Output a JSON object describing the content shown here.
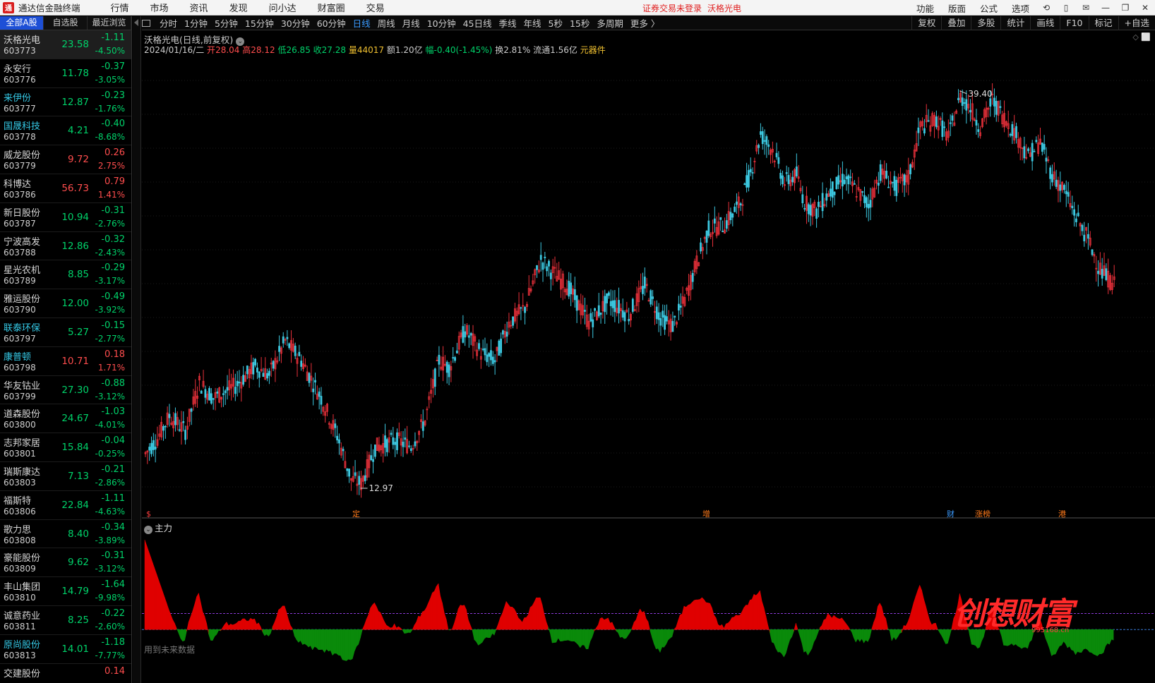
{
  "titlebar": {
    "app_title": "通达信金融终端",
    "logo_glyph": "通",
    "menu": [
      "行情",
      "市场",
      "资讯",
      "发现",
      "问小达",
      "财富圈",
      "交易"
    ],
    "notice": "证券交易未登录",
    "notice_stock": "沃格光电",
    "right_menu": [
      "功能",
      "版面",
      "公式",
      "选项"
    ]
  },
  "list_tabs": [
    "全部A股",
    "自选股",
    "最近浏览"
  ],
  "stocks": [
    {
      "name": "沃格光电",
      "code": "603773",
      "price": "23.58",
      "change": "-1.11",
      "pct": "-4.50%",
      "dir": "dn",
      "cyan": false
    },
    {
      "name": "永安行",
      "code": "603776",
      "price": "11.78",
      "change": "-0.37",
      "pct": "-3.05%",
      "dir": "dn",
      "cyan": false
    },
    {
      "name": "来伊份",
      "code": "603777",
      "price": "12.87",
      "change": "-0.23",
      "pct": "-1.76%",
      "dir": "dn",
      "cyan": true
    },
    {
      "name": "国晟科技",
      "code": "603778",
      "price": "4.21",
      "change": "-0.40",
      "pct": "-8.68%",
      "dir": "dn",
      "cyan": true
    },
    {
      "name": "威龙股份",
      "code": "603779",
      "price": "9.72",
      "change": "0.26",
      "pct": "2.75%",
      "dir": "up",
      "cyan": false
    },
    {
      "name": "科博达",
      "code": "603786",
      "price": "56.73",
      "change": "0.79",
      "pct": "1.41%",
      "dir": "up",
      "cyan": false
    },
    {
      "name": "新日股份",
      "code": "603787",
      "price": "10.94",
      "change": "-0.31",
      "pct": "-2.76%",
      "dir": "dn",
      "cyan": false
    },
    {
      "name": "宁波高发",
      "code": "603788",
      "price": "12.86",
      "change": "-0.32",
      "pct": "-2.43%",
      "dir": "dn",
      "cyan": false
    },
    {
      "name": "星光农机",
      "code": "603789",
      "price": "8.85",
      "change": "-0.29",
      "pct": "-3.17%",
      "dir": "dn",
      "cyan": false
    },
    {
      "name": "雅运股份",
      "code": "603790",
      "price": "12.00",
      "change": "-0.49",
      "pct": "-3.92%",
      "dir": "dn",
      "cyan": false
    },
    {
      "name": "联泰环保",
      "code": "603797",
      "price": "5.27",
      "change": "-0.15",
      "pct": "-2.77%",
      "dir": "dn",
      "cyan": true
    },
    {
      "name": "康普顿",
      "code": "603798",
      "price": "10.71",
      "change": "0.18",
      "pct": "1.71%",
      "dir": "up",
      "cyan": true
    },
    {
      "name": "华友钴业",
      "code": "603799",
      "price": "27.30",
      "change": "-0.88",
      "pct": "-3.12%",
      "dir": "dn",
      "cyan": false
    },
    {
      "name": "道森股份",
      "code": "603800",
      "price": "24.67",
      "change": "-1.03",
      "pct": "-4.01%",
      "dir": "dn",
      "cyan": false
    },
    {
      "name": "志邦家居",
      "code": "603801",
      "price": "15.84",
      "change": "-0.04",
      "pct": "-0.25%",
      "dir": "dn",
      "cyan": false
    },
    {
      "name": "瑞斯康达",
      "code": "603803",
      "price": "7.13",
      "change": "-0.21",
      "pct": "-2.86%",
      "dir": "dn",
      "cyan": false
    },
    {
      "name": "福斯特",
      "code": "603806",
      "price": "22.84",
      "change": "-1.11",
      "pct": "-4.63%",
      "dir": "dn",
      "cyan": false
    },
    {
      "name": "歌力思",
      "code": "603808",
      "price": "8.40",
      "change": "-0.34",
      "pct": "-3.89%",
      "dir": "dn",
      "cyan": false
    },
    {
      "name": "豪能股份",
      "code": "603809",
      "price": "9.62",
      "change": "-0.31",
      "pct": "-3.12%",
      "dir": "dn",
      "cyan": false
    },
    {
      "name": "丰山集团",
      "code": "603810",
      "price": "14.79",
      "change": "-1.64",
      "pct": "-9.98%",
      "dir": "dn",
      "cyan": false
    },
    {
      "name": "诚意药业",
      "code": "603811",
      "price": "8.25",
      "change": "-0.22",
      "pct": "-2.60%",
      "dir": "dn",
      "cyan": false
    },
    {
      "name": "原尚股份",
      "code": "603813",
      "price": "14.01",
      "change": "-1.18",
      "pct": "-7.77%",
      "dir": "dn",
      "cyan": true
    },
    {
      "name": "交建股份",
      "code": "",
      "price": "",
      "change": "0.14",
      "pct": "",
      "dir": "up",
      "cyan": false
    }
  ],
  "periods": [
    "分时",
    "1分钟",
    "5分钟",
    "15分钟",
    "30分钟",
    "60分钟",
    "日线",
    "周线",
    "月线",
    "10分钟",
    "45日线",
    "季线",
    "年线",
    "5秒",
    "15秒",
    "多周期",
    "更多 〉"
  ],
  "active_period": "日线",
  "tools": [
    "复权",
    "叠加",
    "多股",
    "统计",
    "画线",
    "F10",
    "标记",
    "+自选"
  ],
  "chart": {
    "stock_title": "沃格光电(日线,前复权)",
    "date": "2024/01/16/二",
    "open_label": "开",
    "open": "28.04",
    "high_label": "高",
    "high": "28.12",
    "low_label": "低",
    "low": "26.85",
    "close_label": "收",
    "close": "27.28",
    "vol_label": "量",
    "vol": "44017",
    "amt_label": "额",
    "amt": "1.20亿",
    "fluct_label": "幅",
    "fluct": "-0.40(-1.45%)",
    "turnover_label": "换",
    "turnover": "2.81%",
    "float_label": "流通",
    "float": "1.56亿",
    "sector": "元器件",
    "high_mark": "39.40",
    "low_mark": "12.97",
    "events": [
      {
        "label": "$",
        "color": "#ff4040"
      },
      {
        "label": "定",
        "color": "#ff7a1a"
      },
      {
        "label": "增",
        "color": "#ff7a1a"
      },
      {
        "label": "财",
        "color": "#3b9bff"
      },
      {
        "label": "涨榜",
        "color": "#ff7a1a"
      },
      {
        "label": "港",
        "color": "#ff7a1a"
      }
    ],
    "indicator_title": "主力",
    "indicator_note": "用到未来数据",
    "watermark": "创想财富",
    "watermark_url": "995168.cn"
  },
  "chart_data": {
    "type": "candlestick",
    "y_range": [
      11.5,
      41.5
    ],
    "up_color": "#e8303a",
    "down_color": "#3cc8e0",
    "anchors": [
      [
        0,
        15.3
      ],
      [
        6,
        16.3
      ],
      [
        12,
        17.8
      ],
      [
        20,
        16.8
      ],
      [
        27,
        20.0
      ],
      [
        34,
        19.0
      ],
      [
        45,
        19.8
      ],
      [
        55,
        21.1
      ],
      [
        62,
        20.5
      ],
      [
        70,
        22.8
      ],
      [
        78,
        21.5
      ],
      [
        88,
        19.0
      ],
      [
        96,
        16.5
      ],
      [
        103,
        13.6
      ],
      [
        108,
        13.3
      ],
      [
        115,
        15.7
      ],
      [
        125,
        16.2
      ],
      [
        133,
        15.8
      ],
      [
        140,
        17.5
      ],
      [
        147,
        21.5
      ],
      [
        152,
        21.0
      ],
      [
        160,
        23.5
      ],
      [
        168,
        22.0
      ],
      [
        175,
        21.5
      ],
      [
        182,
        24.0
      ],
      [
        190,
        25.0
      ],
      [
        198,
        28.2
      ],
      [
        205,
        27.2
      ],
      [
        212,
        26.3
      ],
      [
        222,
        24.0
      ],
      [
        232,
        25.5
      ],
      [
        242,
        24.5
      ],
      [
        250,
        26.5
      ],
      [
        258,
        24.3
      ],
      [
        264,
        23.8
      ],
      [
        270,
        25.5
      ],
      [
        276,
        28.0
      ],
      [
        282,
        30.2
      ],
      [
        290,
        30.5
      ],
      [
        298,
        32.0
      ],
      [
        303,
        34.0
      ],
      [
        308,
        36.5
      ],
      [
        314,
        35.5
      ],
      [
        320,
        33.3
      ],
      [
        326,
        33.8
      ],
      [
        330,
        32.0
      ],
      [
        336,
        31.4
      ],
      [
        342,
        32.6
      ],
      [
        350,
        33.6
      ],
      [
        358,
        32.5
      ],
      [
        362,
        31.8
      ],
      [
        368,
        34.0
      ],
      [
        376,
        33.0
      ],
      [
        382,
        33.6
      ],
      [
        388,
        37.0
      ],
      [
        396,
        37.5
      ],
      [
        402,
        36.3
      ],
      [
        408,
        39.0
      ],
      [
        412,
        38.5
      ],
      [
        418,
        37.0
      ],
      [
        424,
        38.8
      ],
      [
        430,
        37.6
      ],
      [
        436,
        36.5
      ],
      [
        442,
        35.0
      ],
      [
        448,
        36.0
      ],
      [
        454,
        33.8
      ],
      [
        460,
        32.8
      ],
      [
        466,
        31.0
      ],
      [
        472,
        29.5
      ],
      [
        478,
        27.5
      ],
      [
        485,
        26.5
      ]
    ],
    "indicator_y_range": [
      -7,
      30
    ],
    "indicator_levels": [
      5,
      0
    ]
  }
}
